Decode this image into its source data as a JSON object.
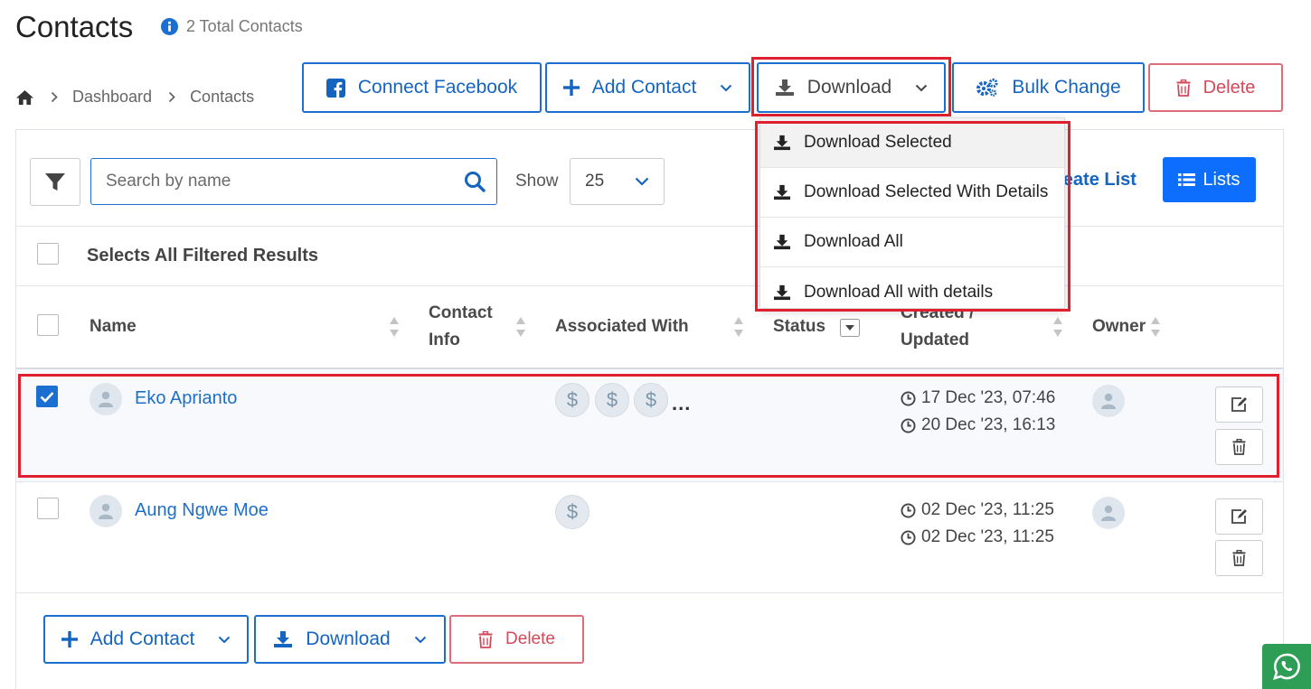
{
  "header": {
    "title": "Contacts",
    "total": "2 Total Contacts"
  },
  "breadcrumb": [
    "Dashboard",
    "Contacts"
  ],
  "toolbar": {
    "connect_facebook": "Connect Facebook",
    "add_contact": "Add Contact",
    "download": "Download",
    "bulk_change": "Bulk Change",
    "delete": "Delete"
  },
  "download_menu": {
    "items": [
      "Download Selected",
      "Download Selected With Details",
      "Download All",
      "Download All with details"
    ]
  },
  "filters": {
    "search_placeholder": "Search by name",
    "show_label": "Show",
    "show_value": "25",
    "create_list": "reate List",
    "lists": "Lists"
  },
  "table": {
    "select_all": "Selects All Filtered Results",
    "columns": {
      "name": "Name",
      "contact_info_1": "Contact",
      "contact_info_2": "Info",
      "associated": "Associated With",
      "status": "Status",
      "created_1": "Created /",
      "created_2": "Updated",
      "owner": "Owner"
    },
    "rows": [
      {
        "name": "Eko Aprianto",
        "checked": true,
        "associations": 3,
        "more": "...",
        "created": "17 Dec '23, 07:46",
        "updated": "20 Dec '23, 16:13"
      },
      {
        "name": "Aung Ngwe Moe",
        "checked": false,
        "associations": 1,
        "created": "02 Dec '23, 11:25",
        "updated": "02 Dec '23, 11:25"
      }
    ]
  },
  "footer": {
    "add_contact": "Add Contact",
    "download": "Download",
    "delete": "Delete"
  },
  "colors": {
    "primary": "#1a6fd1",
    "danger": "#d24a5a",
    "highlight": "#e0202e",
    "whatsapp": "#2e9e57"
  }
}
